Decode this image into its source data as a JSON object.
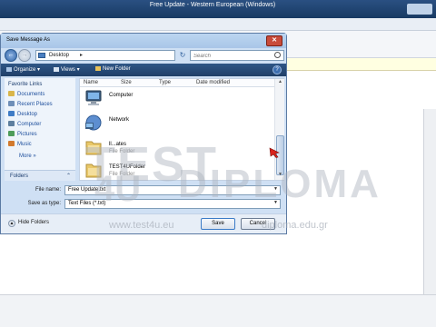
{
  "app": {
    "title": "Free Update - Western European (Windows)"
  },
  "dialog": {
    "title": "Save Message As",
    "address": "Desktop",
    "search_placeholder": "Search",
    "commands": {
      "organize": "Organize",
      "views": "Views",
      "new_folder": "New Folder"
    },
    "favorites_heading": "Favorite Links",
    "favorites": [
      {
        "label": "Documents",
        "icon": "documents-icon",
        "color": "#d9b64a"
      },
      {
        "label": "Recent Places",
        "icon": "recent-places-icon",
        "color": "#6f8fb8"
      },
      {
        "label": "Desktop",
        "icon": "desktop-icon",
        "color": "#3f7cc6"
      },
      {
        "label": "Computer",
        "icon": "computer-icon",
        "color": "#5e7f9f"
      },
      {
        "label": "Pictures",
        "icon": "pictures-icon",
        "color": "#4e9c5a"
      },
      {
        "label": "Music",
        "icon": "music-icon",
        "color": "#d27a2e"
      },
      {
        "label": "Searches",
        "icon": "searches-icon",
        "color": "#6c8fb7"
      }
    ],
    "more_label": "More",
    "folders_label": "Folders",
    "columns": [
      "Name",
      "Size",
      "Type",
      "Date modified"
    ],
    "items": [
      {
        "name": "Computer",
        "sub": "",
        "icon": "computer-icon"
      },
      {
        "name": "Network",
        "sub": "",
        "icon": "network-icon"
      },
      {
        "name": "ll...ates",
        "sub": "File Folder",
        "icon": "folder-icon"
      },
      {
        "name": "TEST4UFolder",
        "sub": "File Folder",
        "icon": "folder-icon"
      }
    ],
    "file_name_label": "File name:",
    "file_name_value": "Free Update.txt",
    "save_as_type_label": "Save as type:",
    "save_as_type_value": "Text Files (*.txt)",
    "hide_folders_label": "Hide Folders",
    "save_label": "Save",
    "cancel_label": "Cancel"
  },
  "watermark": {
    "line1": "TEST",
    "line2": "4U",
    "line3": "DIPLOMA",
    "url1": "www.test4u.eu",
    "url2": "diploma.edu.gr"
  },
  "colors": {
    "command_bar": "#1f3f68",
    "dialog_frame": "#cfe0f4",
    "accent_link": "#1d4e9c",
    "pointer_red": "#d8231c"
  }
}
